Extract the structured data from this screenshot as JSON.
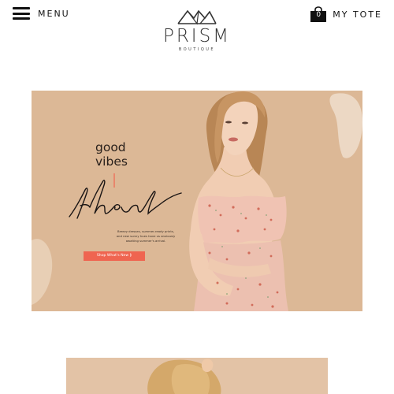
{
  "header": {
    "menu_label": "MENU",
    "logo_name": "PRISM",
    "logo_sub": "BOUTIQUE",
    "tote_count": "0",
    "tote_label": "MY TOTE"
  },
  "hero": {
    "headline": [
      "good",
      "vibes"
    ],
    "script_word": "ahead",
    "tagline": [
      "Breezy dresses, summer-ready prints,",
      "and new sunny hues have us anxiously",
      "awaiting summer's arrival."
    ],
    "cta_label": "Shop What's New ⟫"
  },
  "colors": {
    "hero_background": "#dcb896",
    "cta": "#ef6550",
    "accent_line": "#ef6550"
  }
}
